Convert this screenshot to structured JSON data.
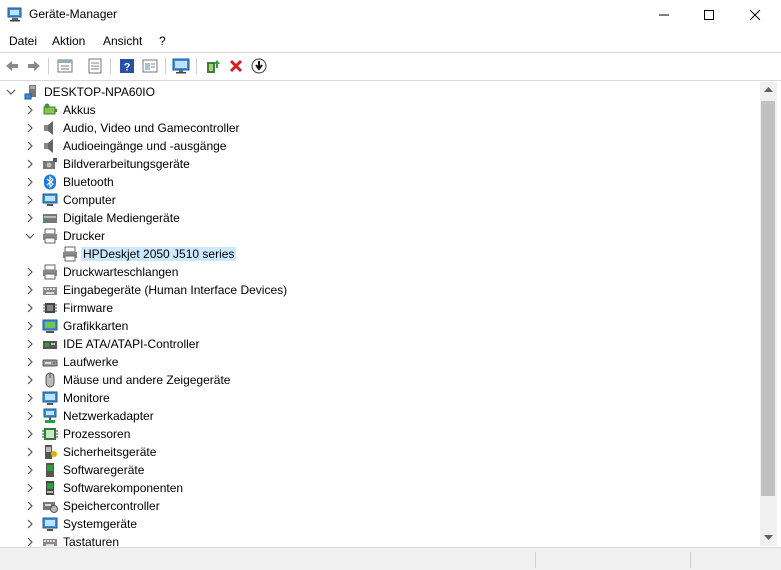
{
  "window": {
    "title": "Geräte-Manager"
  },
  "menu": [
    "Datei",
    "Aktion",
    "Ansicht",
    "?"
  ],
  "toolbar": [
    "back-icon",
    "forward-icon",
    "properties-icon",
    "list-view-icon",
    "help-icon",
    "device-view-icon",
    "monitor-scan-icon",
    "update-driver-icon",
    "uninstall-icon",
    "download-icon"
  ],
  "tree": {
    "root": "DESKTOP-NPA60IO",
    "items": [
      {
        "label": "Akkus",
        "icon": "battery-icon"
      },
      {
        "label": "Audio, Video und Gamecontroller",
        "icon": "speaker-icon"
      },
      {
        "label": "Audioeingänge und -ausgänge",
        "icon": "speaker-icon"
      },
      {
        "label": "Bildverarbeitungsgeräte",
        "icon": "camera-icon"
      },
      {
        "label": "Bluetooth",
        "icon": "bluetooth-icon"
      },
      {
        "label": "Computer",
        "icon": "computer-icon"
      },
      {
        "label": "Digitale Mediengeräte",
        "icon": "media-device-icon"
      },
      {
        "label": "Drucker",
        "icon": "printer-icon",
        "expanded": true
      },
      {
        "label": "HPDeskjet 2050 J510 series",
        "icon": "printer-icon",
        "child": true,
        "selected": true
      },
      {
        "label": "Druckwarteschlangen",
        "icon": "printer-icon"
      },
      {
        "label": "Eingabegeräte (Human Interface Devices)",
        "icon": "keyboard-icon"
      },
      {
        "label": "Firmware",
        "icon": "chip-icon"
      },
      {
        "label": "Grafikkarten",
        "icon": "display-adapter-icon"
      },
      {
        "label": "IDE ATA/ATAPI-Controller",
        "icon": "controller-icon"
      },
      {
        "label": "Laufwerke",
        "icon": "drive-icon"
      },
      {
        "label": "Mäuse und andere Zeigegeräte",
        "icon": "mouse-icon"
      },
      {
        "label": "Monitore",
        "icon": "monitor-icon"
      },
      {
        "label": "Netzwerkadapter",
        "icon": "network-icon"
      },
      {
        "label": "Prozessoren",
        "icon": "processor-icon"
      },
      {
        "label": "Sicherheitsgeräte",
        "icon": "security-icon"
      },
      {
        "label": "Softwaregeräte",
        "icon": "software-device-icon"
      },
      {
        "label": "Softwarekomponenten",
        "icon": "software-component-icon"
      },
      {
        "label": "Speichercontroller",
        "icon": "storage-controller-icon"
      },
      {
        "label": "Systemgeräte",
        "icon": "system-device-icon"
      },
      {
        "label": "Tastaturen",
        "icon": "keyboard-icon"
      }
    ]
  },
  "colors": {
    "selection": "#cce8ff",
    "accent": "#0078d7"
  }
}
